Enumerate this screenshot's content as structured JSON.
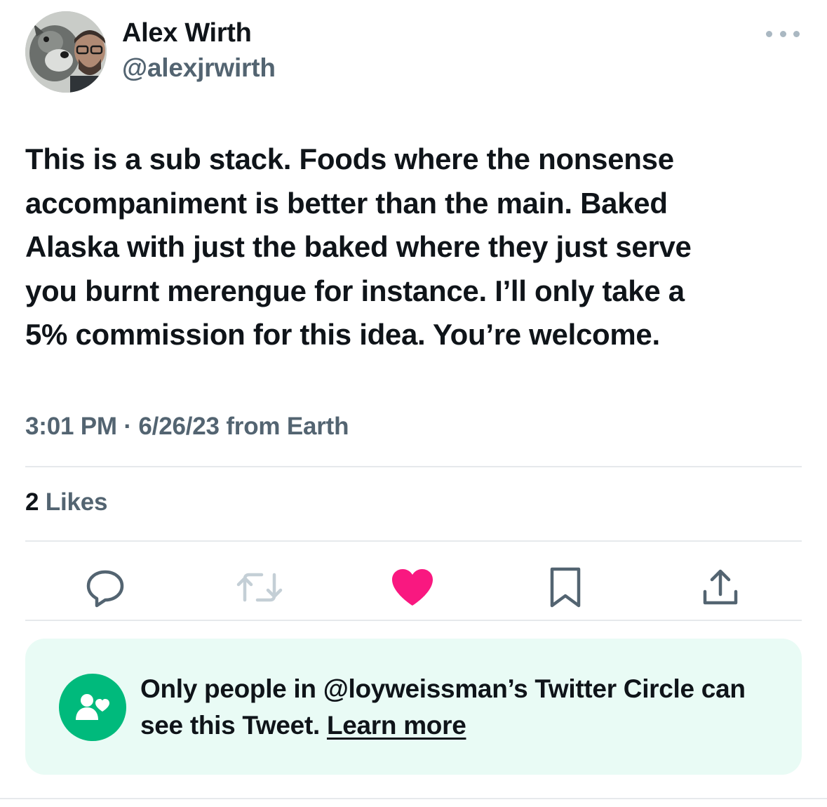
{
  "author": {
    "name": "Alex Wirth",
    "handle": "@alexjrwirth"
  },
  "tweet": {
    "text": "This is a sub stack. Foods where the nonsense\naccompaniment is better than the main. Baked\nAlaska with just the baked where they just serve\nyou burnt merengue for instance. I’ll only take a\n5% commission for this idea. You’re welcome.",
    "time": "3:01 PM",
    "separator": "·",
    "date": "6/26/23",
    "source": "from Earth"
  },
  "stats": {
    "likes_count": "2",
    "likes_label": "Likes"
  },
  "actions": {
    "reply_icon": "speech-bubble-icon",
    "retweet_icon": "retweet-arrows-icon",
    "like_icon": "heart-icon",
    "bookmark_icon": "bookmark-icon",
    "share_icon": "share-upload-icon",
    "like_active": true
  },
  "circle_notice": {
    "text": "Only people in @loyweissman’s Twitter Circle can see this Tweet.",
    "link": "Learn more",
    "icon": "people-heart-icon"
  },
  "colors": {
    "text_primary": "#0f1419",
    "text_secondary": "#536471",
    "like_pink": "#f91880",
    "circle_green": "#00ba7c",
    "circle_bg": "#e9fbf5",
    "retweet_disabled": "#c4cfd6"
  }
}
